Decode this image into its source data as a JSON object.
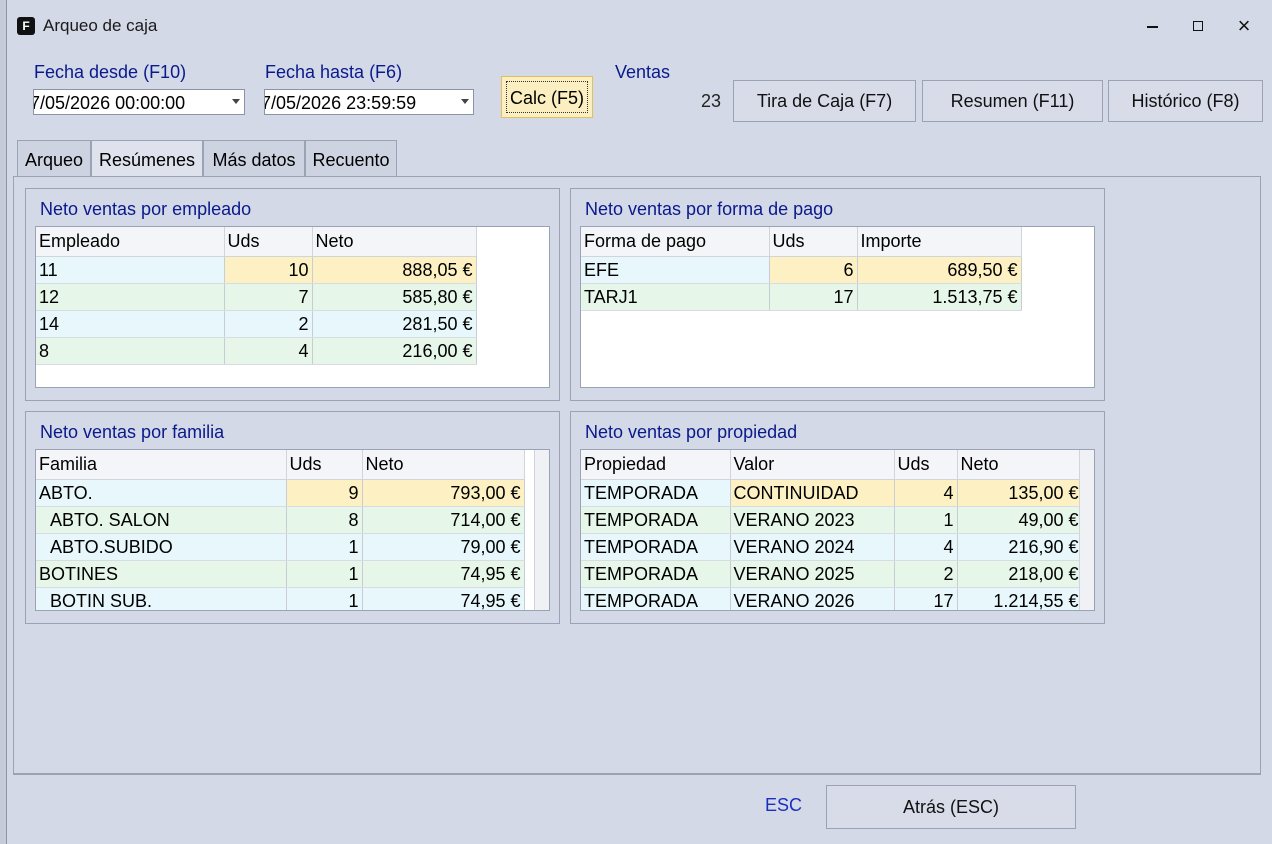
{
  "window": {
    "title": "Arqueo de caja",
    "app_icon": "F",
    "minimize": "minimize-icon",
    "maximize": "maximize-icon",
    "close": "×"
  },
  "header": {
    "fecha_desde_label": "Fecha desde (F10)",
    "fecha_desde_value": "7/05/2026 00:00:00",
    "fecha_hasta_label": "Fecha hasta (F6)",
    "fecha_hasta_value": "7/05/2026 23:59:59",
    "calc_label": "Calc (F5)",
    "ventas_label": "Ventas",
    "ventas_count": "23",
    "tira_label": "Tira de Caja (F7)",
    "resumen_label": "Resumen (F11)",
    "historico_label": "Histórico (F8)"
  },
  "tabs": [
    "Arqueo",
    "Resúmenes",
    "Más datos",
    "Recuento"
  ],
  "active_tab": 1,
  "empleado": {
    "title": "Neto ventas por empleado",
    "headers": [
      "Empleado",
      "Uds",
      "Neto"
    ],
    "rows": [
      [
        "11",
        "10",
        "888,05 €"
      ],
      [
        "12",
        "7",
        "585,80 €"
      ],
      [
        "14",
        "2",
        "281,50 €"
      ],
      [
        "8",
        "4",
        "216,00 €"
      ]
    ]
  },
  "formapago": {
    "title": "Neto ventas por forma de pago",
    "headers": [
      "Forma de pago",
      "Uds",
      "Importe"
    ],
    "rows": [
      [
        "EFE",
        "6",
        "689,50 €"
      ],
      [
        "TARJ1",
        "17",
        "1.513,75 €"
      ]
    ]
  },
  "familia": {
    "title": "Neto ventas por familia",
    "headers": [
      "Familia",
      "Uds",
      "Neto"
    ],
    "rows": [
      [
        "ABTO.",
        "9",
        "793,00 €"
      ],
      [
        "ABTO. SALON",
        "8",
        "714,00 €"
      ],
      [
        "ABTO.SUBIDO",
        "1",
        "79,00 €"
      ],
      [
        "BOTINES",
        "1",
        "74,95 €"
      ],
      [
        "BOTIN SUB.",
        "1",
        "74,95 €"
      ]
    ]
  },
  "propiedad": {
    "title": "Neto ventas por propiedad",
    "headers": [
      "Propiedad",
      "Valor",
      "Uds",
      "Neto"
    ],
    "rows": [
      [
        "TEMPORADA",
        "CONTINUIDAD",
        "4",
        "135,00 €"
      ],
      [
        "TEMPORADA",
        "VERANO 2023",
        "1",
        "49,00 €"
      ],
      [
        "TEMPORADA",
        "VERANO 2024",
        "4",
        "216,90 €"
      ],
      [
        "TEMPORADA",
        "VERANO 2025",
        "2",
        "218,00 €"
      ],
      [
        "TEMPORADA",
        "VERANO 2026",
        "17",
        "1.214,55 €"
      ]
    ]
  },
  "footer": {
    "esc_label": "ESC",
    "back_label": "Atrás (ESC)"
  }
}
